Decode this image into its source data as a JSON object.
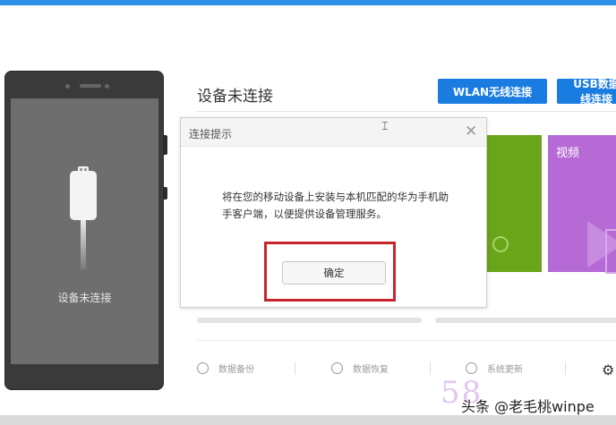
{
  "phone": {
    "status_label": "设备未连接"
  },
  "header": {
    "title": "设备未连接",
    "wlan_button": "WLAN无线连接",
    "usb_button": "USB数据线连接"
  },
  "tiles": {
    "video_label": "视频"
  },
  "bottom_bar": {
    "backup": "数据备份",
    "restore": "数据恢复",
    "update": "系统更新",
    "settings_icon": "gear-icon"
  },
  "dialog": {
    "title": "连接提示",
    "message": "将在您的移动设备上安装与本机匹配的华为手机助手客户端，以便提供设备管理服务。",
    "ok_button": "确定",
    "highlight_color": "#c8262e"
  },
  "watermark": {
    "number": "58",
    "text": "头条 @老毛桃winpe"
  },
  "colors": {
    "accent": "#1a7ce0",
    "topbar": "#2f8ee6",
    "green_tile": "#6aa419",
    "purple_tile": "#b66ad6"
  }
}
